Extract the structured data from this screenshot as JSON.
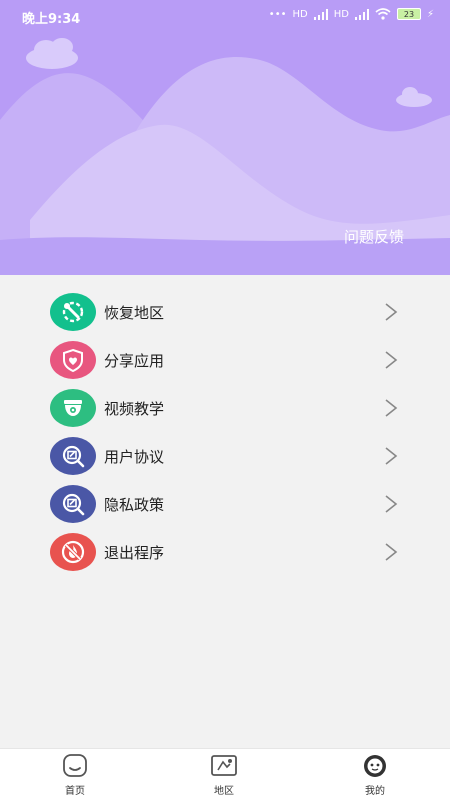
{
  "status_bar": {
    "time": "晚上9:34",
    "network_1": "HD",
    "network_2": "HD",
    "battery": "23"
  },
  "header": {
    "feedback_label": "问题反馈"
  },
  "menu": {
    "items": [
      {
        "label": "恢复地区",
        "icon": "wrench-gear-icon",
        "color": "#12c08d"
      },
      {
        "label": "分享应用",
        "icon": "shield-heart-icon",
        "color": "#e8567f"
      },
      {
        "label": "视频教学",
        "icon": "camera-icon",
        "color": "#2dbe81"
      },
      {
        "label": "用户协议",
        "icon": "document-search-icon",
        "color": "#4a57a6"
      },
      {
        "label": "隐私政策",
        "icon": "document-search-icon",
        "color": "#4a57a6"
      },
      {
        "label": "退出程序",
        "icon": "no-fire-icon",
        "color": "#e8534f"
      }
    ]
  },
  "tabs": [
    {
      "label": "首页",
      "icon": "home-icon"
    },
    {
      "label": "地区",
      "icon": "map-icon"
    },
    {
      "label": "我的",
      "icon": "profile-icon"
    }
  ],
  "colors": {
    "header_bg": "#b89cf6",
    "page_bg": "#f2f2f2"
  }
}
